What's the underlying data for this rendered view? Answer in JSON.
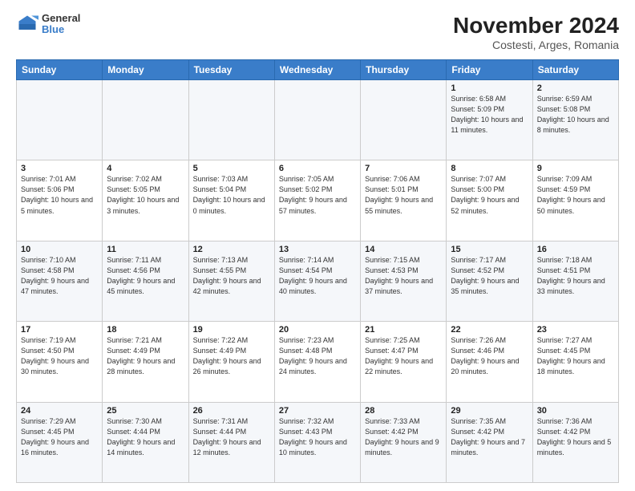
{
  "header": {
    "logo_line1": "General",
    "logo_line2": "Blue",
    "title": "November 2024",
    "subtitle": "Costesti, Arges, Romania"
  },
  "weekdays": [
    "Sunday",
    "Monday",
    "Tuesday",
    "Wednesday",
    "Thursday",
    "Friday",
    "Saturday"
  ],
  "weeks": [
    [
      {
        "day": "",
        "info": ""
      },
      {
        "day": "",
        "info": ""
      },
      {
        "day": "",
        "info": ""
      },
      {
        "day": "",
        "info": ""
      },
      {
        "day": "",
        "info": ""
      },
      {
        "day": "1",
        "info": "Sunrise: 6:58 AM\nSunset: 5:09 PM\nDaylight: 10 hours and 11 minutes."
      },
      {
        "day": "2",
        "info": "Sunrise: 6:59 AM\nSunset: 5:08 PM\nDaylight: 10 hours and 8 minutes."
      }
    ],
    [
      {
        "day": "3",
        "info": "Sunrise: 7:01 AM\nSunset: 5:06 PM\nDaylight: 10 hours and 5 minutes."
      },
      {
        "day": "4",
        "info": "Sunrise: 7:02 AM\nSunset: 5:05 PM\nDaylight: 10 hours and 3 minutes."
      },
      {
        "day": "5",
        "info": "Sunrise: 7:03 AM\nSunset: 5:04 PM\nDaylight: 10 hours and 0 minutes."
      },
      {
        "day": "6",
        "info": "Sunrise: 7:05 AM\nSunset: 5:02 PM\nDaylight: 9 hours and 57 minutes."
      },
      {
        "day": "7",
        "info": "Sunrise: 7:06 AM\nSunset: 5:01 PM\nDaylight: 9 hours and 55 minutes."
      },
      {
        "day": "8",
        "info": "Sunrise: 7:07 AM\nSunset: 5:00 PM\nDaylight: 9 hours and 52 minutes."
      },
      {
        "day": "9",
        "info": "Sunrise: 7:09 AM\nSunset: 4:59 PM\nDaylight: 9 hours and 50 minutes."
      }
    ],
    [
      {
        "day": "10",
        "info": "Sunrise: 7:10 AM\nSunset: 4:58 PM\nDaylight: 9 hours and 47 minutes."
      },
      {
        "day": "11",
        "info": "Sunrise: 7:11 AM\nSunset: 4:56 PM\nDaylight: 9 hours and 45 minutes."
      },
      {
        "day": "12",
        "info": "Sunrise: 7:13 AM\nSunset: 4:55 PM\nDaylight: 9 hours and 42 minutes."
      },
      {
        "day": "13",
        "info": "Sunrise: 7:14 AM\nSunset: 4:54 PM\nDaylight: 9 hours and 40 minutes."
      },
      {
        "day": "14",
        "info": "Sunrise: 7:15 AM\nSunset: 4:53 PM\nDaylight: 9 hours and 37 minutes."
      },
      {
        "day": "15",
        "info": "Sunrise: 7:17 AM\nSunset: 4:52 PM\nDaylight: 9 hours and 35 minutes."
      },
      {
        "day": "16",
        "info": "Sunrise: 7:18 AM\nSunset: 4:51 PM\nDaylight: 9 hours and 33 minutes."
      }
    ],
    [
      {
        "day": "17",
        "info": "Sunrise: 7:19 AM\nSunset: 4:50 PM\nDaylight: 9 hours and 30 minutes."
      },
      {
        "day": "18",
        "info": "Sunrise: 7:21 AM\nSunset: 4:49 PM\nDaylight: 9 hours and 28 minutes."
      },
      {
        "day": "19",
        "info": "Sunrise: 7:22 AM\nSunset: 4:49 PM\nDaylight: 9 hours and 26 minutes."
      },
      {
        "day": "20",
        "info": "Sunrise: 7:23 AM\nSunset: 4:48 PM\nDaylight: 9 hours and 24 minutes."
      },
      {
        "day": "21",
        "info": "Sunrise: 7:25 AM\nSunset: 4:47 PM\nDaylight: 9 hours and 22 minutes."
      },
      {
        "day": "22",
        "info": "Sunrise: 7:26 AM\nSunset: 4:46 PM\nDaylight: 9 hours and 20 minutes."
      },
      {
        "day": "23",
        "info": "Sunrise: 7:27 AM\nSunset: 4:45 PM\nDaylight: 9 hours and 18 minutes."
      }
    ],
    [
      {
        "day": "24",
        "info": "Sunrise: 7:29 AM\nSunset: 4:45 PM\nDaylight: 9 hours and 16 minutes."
      },
      {
        "day": "25",
        "info": "Sunrise: 7:30 AM\nSunset: 4:44 PM\nDaylight: 9 hours and 14 minutes."
      },
      {
        "day": "26",
        "info": "Sunrise: 7:31 AM\nSunset: 4:44 PM\nDaylight: 9 hours and 12 minutes."
      },
      {
        "day": "27",
        "info": "Sunrise: 7:32 AM\nSunset: 4:43 PM\nDaylight: 9 hours and 10 minutes."
      },
      {
        "day": "28",
        "info": "Sunrise: 7:33 AM\nSunset: 4:42 PM\nDaylight: 9 hours and 9 minutes."
      },
      {
        "day": "29",
        "info": "Sunrise: 7:35 AM\nSunset: 4:42 PM\nDaylight: 9 hours and 7 minutes."
      },
      {
        "day": "30",
        "info": "Sunrise: 7:36 AM\nSunset: 4:42 PM\nDaylight: 9 hours and 5 minutes."
      }
    ]
  ]
}
